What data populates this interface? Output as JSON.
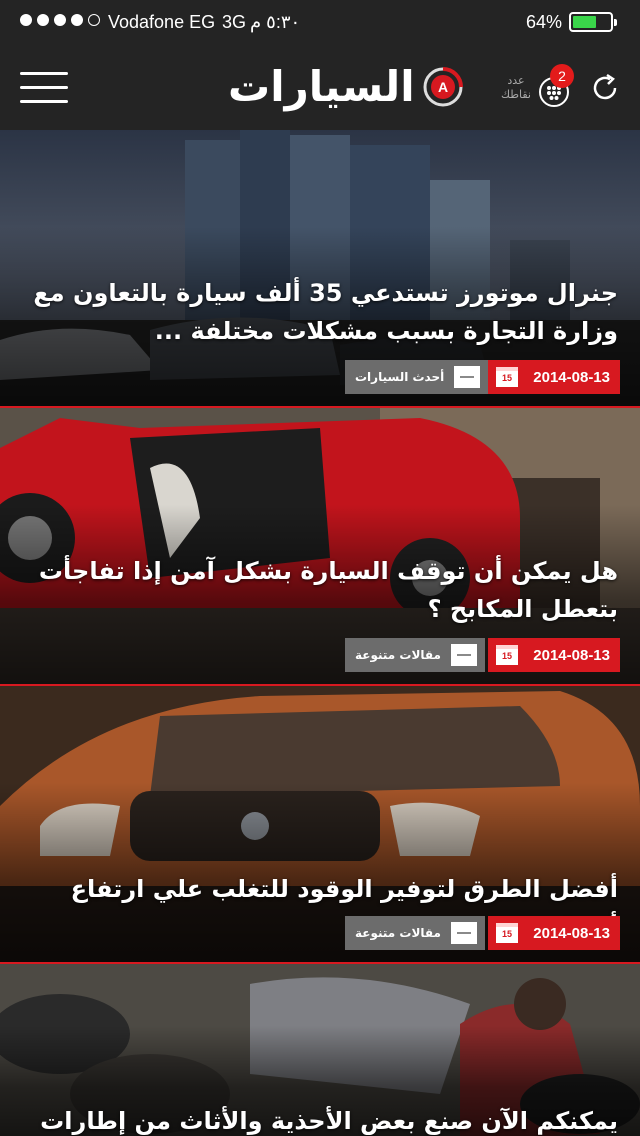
{
  "status_bar": {
    "carrier": "Vodafone EG",
    "network": "3G",
    "time": "٥:٣٠ م",
    "battery_percent": "64%",
    "battery_level": 0.64,
    "signal_bars": 4
  },
  "header": {
    "logo_text": "السيارات",
    "points_label": "عدد نقاطك",
    "points_count": "2",
    "icons": {
      "menu": "hamburger-menu-icon",
      "points": "points-dots-icon",
      "refresh": "refresh-icon"
    }
  },
  "colors": {
    "accent": "#d71920",
    "navbar": "#242424",
    "category_chip": "#6c6c6c",
    "battery": "#3ad54a"
  },
  "articles": [
    {
      "title": "جنرال موتورز تستدعي 35 ألف سيارة بالتعاون مع وزارة التجارة بسبب مشكلات مختلفة ...",
      "date": "2014-08-13",
      "calendar_day": "15",
      "category": "أحدث السيارات"
    },
    {
      "title": "هل يمكن أن توقف السيارة بشكل آمن إذا تفاجأت بتعطل المكابح ؟",
      "date": "2014-08-13",
      "calendar_day": "15",
      "category": "مقالات متنوعة"
    },
    {
      "title": "أفضل الطرق لتوفير الوقود للتغلب علي ارتفاع أسعاره",
      "date": "2014-08-13",
      "calendar_day": "15",
      "category": "مقالات متنوعة"
    },
    {
      "title": "يمكنكم الآن صنع بعض الأحذية والأثاث من إطارات السيارات",
      "date": "",
      "calendar_day": "",
      "category": ""
    }
  ]
}
